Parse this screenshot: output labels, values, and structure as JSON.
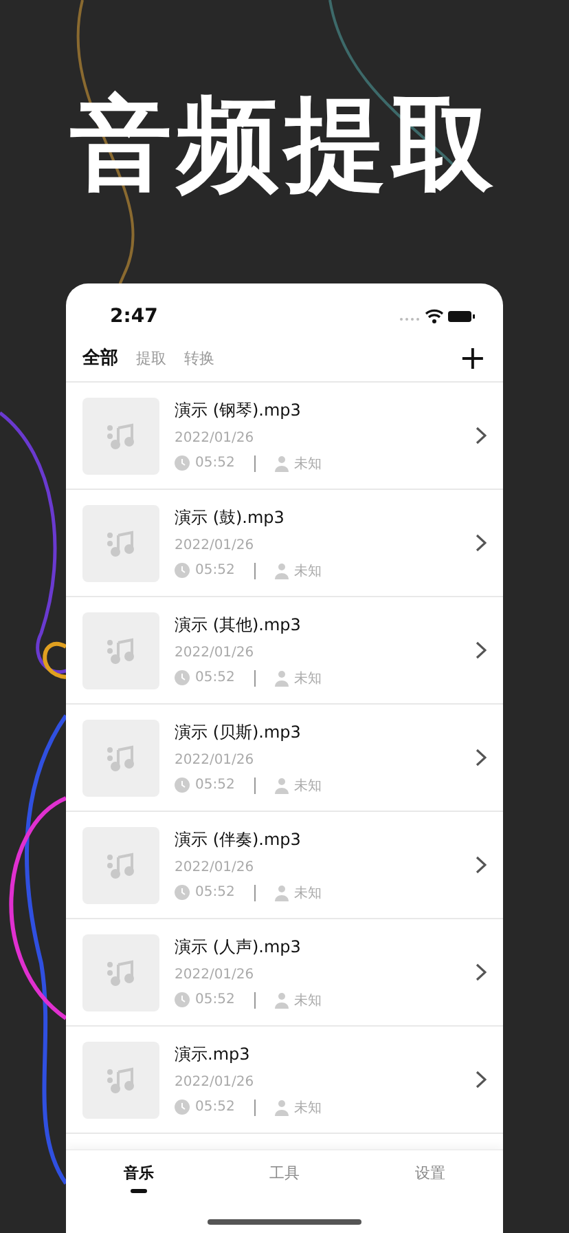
{
  "headline": "音频提取",
  "status_bar": {
    "time": "2:47"
  },
  "filter_tabs": [
    {
      "label": "全部",
      "selected": true
    },
    {
      "label": "提取",
      "selected": false
    },
    {
      "label": "转换",
      "selected": false
    }
  ],
  "add_button": "+",
  "files": [
    {
      "name": "演示 (钢琴).mp3",
      "date": "2022/01/26",
      "duration": "05:52",
      "artist": "未知"
    },
    {
      "name": "演示 (鼓).mp3",
      "date": "2022/01/26",
      "duration": "05:52",
      "artist": "未知"
    },
    {
      "name": "演示 (其他).mp3",
      "date": "2022/01/26",
      "duration": "05:52",
      "artist": "未知"
    },
    {
      "name": "演示 (贝斯).mp3",
      "date": "2022/01/26",
      "duration": "05:52",
      "artist": "未知"
    },
    {
      "name": "演示 (伴奏).mp3",
      "date": "2022/01/26",
      "duration": "05:52",
      "artist": "未知"
    },
    {
      "name": "演示 (人声).mp3",
      "date": "2022/01/26",
      "duration": "05:52",
      "artist": "未知"
    },
    {
      "name": "演示.mp3",
      "date": "2022/01/26",
      "duration": "05:52",
      "artist": "未知"
    }
  ],
  "bottom_tabs": [
    {
      "label": "音乐",
      "selected": true
    },
    {
      "label": "工具",
      "selected": false
    },
    {
      "label": "设置",
      "selected": false
    }
  ]
}
